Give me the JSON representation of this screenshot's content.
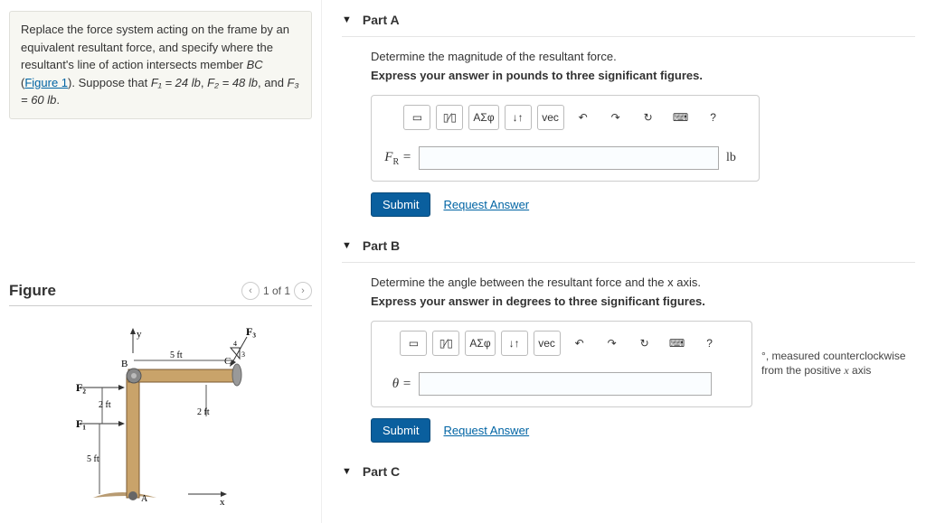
{
  "problem": {
    "text_pre": "Replace the force system acting on the frame by an equivalent resultant force, and specify where the resultant's line of action intersects member ",
    "member": "BC",
    "link": "Figure 1",
    "suppose_pre": "). Suppose that ",
    "f1": "F₁ = 24 lb",
    "f2": "F₂ = 48 lb",
    "and": ", and ",
    "f3": "F₃ = 60 lb",
    "dot": "."
  },
  "figure": {
    "title": "Figure",
    "nav_prev": "‹",
    "nav_text": "1 of 1",
    "nav_next": "›",
    "labels": {
      "y": "y",
      "x": "x",
      "B": "B",
      "C": "C",
      "A": "A",
      "F1": "F₁",
      "F2": "F₂",
      "F3": "F₃",
      "d_top": "5 ft",
      "d_left1": "2 ft",
      "d_left2": "5 ft",
      "d_right": "2 ft"
    }
  },
  "toolbar_btns": {
    "tmpl": "▭",
    "frac": "▯⁄▯",
    "greek": "ΑΣφ",
    "sort": "↓↑",
    "vec": "vec",
    "undo": "↶",
    "redo": "↷",
    "reset": "↻",
    "kb": "⌨",
    "help": "?"
  },
  "partA": {
    "title": "Part A",
    "instr": "Determine the magnitude of the resultant force.",
    "bold": "Express your answer in pounds to three significant figures.",
    "var": "F",
    "sub": "R",
    "eq": " = ",
    "unit": "lb",
    "submit": "Submit",
    "request": "Request Answer"
  },
  "partB": {
    "title": "Part B",
    "instr": "Determine the angle between the resultant force and the x axis.",
    "bold": "Express your answer in degrees to three significant figures.",
    "var": "θ",
    "eq": " = ",
    "suffix_deg": "°",
    "suffix_txt": ", measured counterclockwise from the positive ",
    "suffix_x": "x",
    "suffix_axis": " axis",
    "submit": "Submit",
    "request": "Request Answer"
  },
  "partC": {
    "title": "Part C"
  }
}
